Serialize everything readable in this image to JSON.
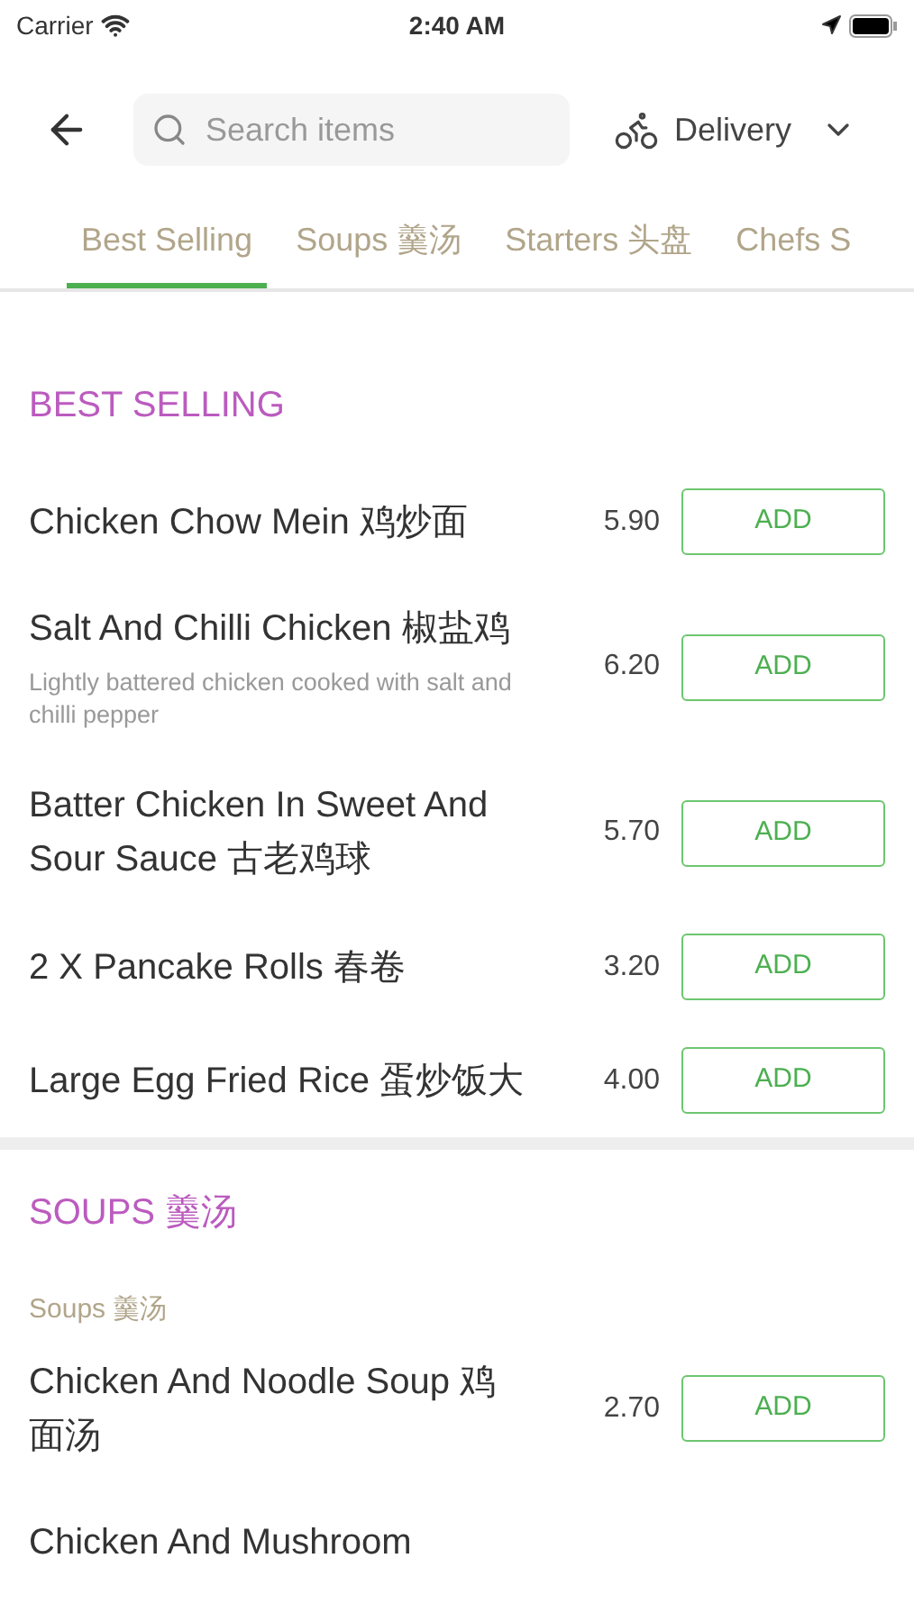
{
  "status_bar": {
    "carrier": "Carrier",
    "time": "2:40 AM"
  },
  "header": {
    "search": {
      "placeholder": "Search items"
    },
    "mode": "Delivery"
  },
  "tabs": [
    {
      "label": "Best Selling",
      "selected": true
    },
    {
      "label": "Soups 羹汤",
      "selected": false
    },
    {
      "label": "Starters 头盘",
      "selected": false
    },
    {
      "label": "Chefs S",
      "selected": false
    }
  ],
  "sections": [
    {
      "title": "BEST SELLING",
      "items": [
        {
          "name": "Chicken Chow Mein 鸡炒面",
          "price": "5.90",
          "button": "ADD"
        },
        {
          "name": "Salt And Chilli Chicken 椒盐鸡",
          "description": "Lightly battered chicken cooked with salt and chilli pepper",
          "price": "6.20",
          "button": "ADD"
        },
        {
          "name": "Batter Chicken In Sweet And Sour Sauce 古老鸡球",
          "price": "5.70",
          "button": "ADD"
        },
        {
          "name": "2 X Pancake Rolls 春卷",
          "price": "3.20",
          "button": "ADD"
        },
        {
          "name": "Large Egg Fried Rice 蛋炒饭大",
          "price": "4.00",
          "button": "ADD"
        }
      ]
    },
    {
      "title": "SOUPS 羹汤",
      "subtitle": "Soups 羹汤",
      "items": [
        {
          "name": "Chicken And Noodle Soup 鸡面汤",
          "price": "2.70",
          "button": "ADD"
        },
        {
          "name": "Chicken And Mushroom"
        }
      ]
    }
  ]
}
